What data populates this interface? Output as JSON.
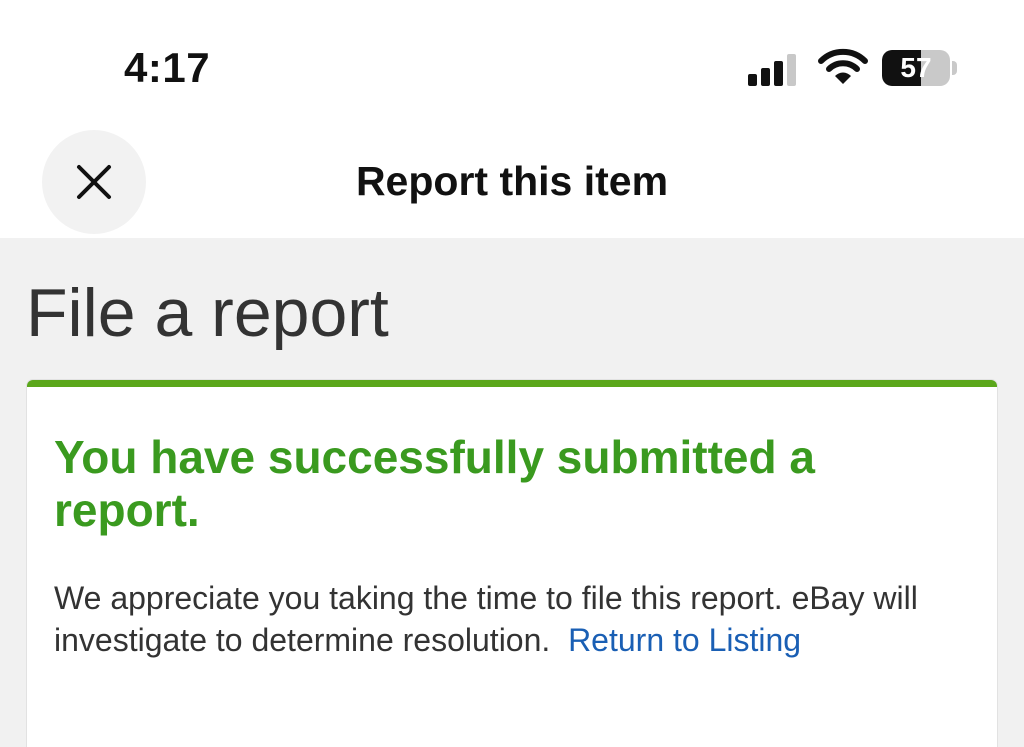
{
  "status_bar": {
    "time": "4:17",
    "battery_level": "57",
    "battery_fraction": 0.57,
    "icons": [
      "signal-icon",
      "wifi-icon",
      "battery-icon"
    ]
  },
  "header": {
    "title": "Report this item",
    "close_icon": "close-icon"
  },
  "main": {
    "page_title": "File a report",
    "card": {
      "heading": "You have successfully submitted a report.",
      "body": "We appreciate you taking the time to file this report. eBay will investigate to determine resolution.",
      "link_label": "Return to Listing"
    }
  },
  "colors": {
    "success_green": "#3a9a1f",
    "card_border_green": "#5ba71b",
    "link_blue": "#1a5fb4",
    "background_gray": "#f1f1f1"
  }
}
